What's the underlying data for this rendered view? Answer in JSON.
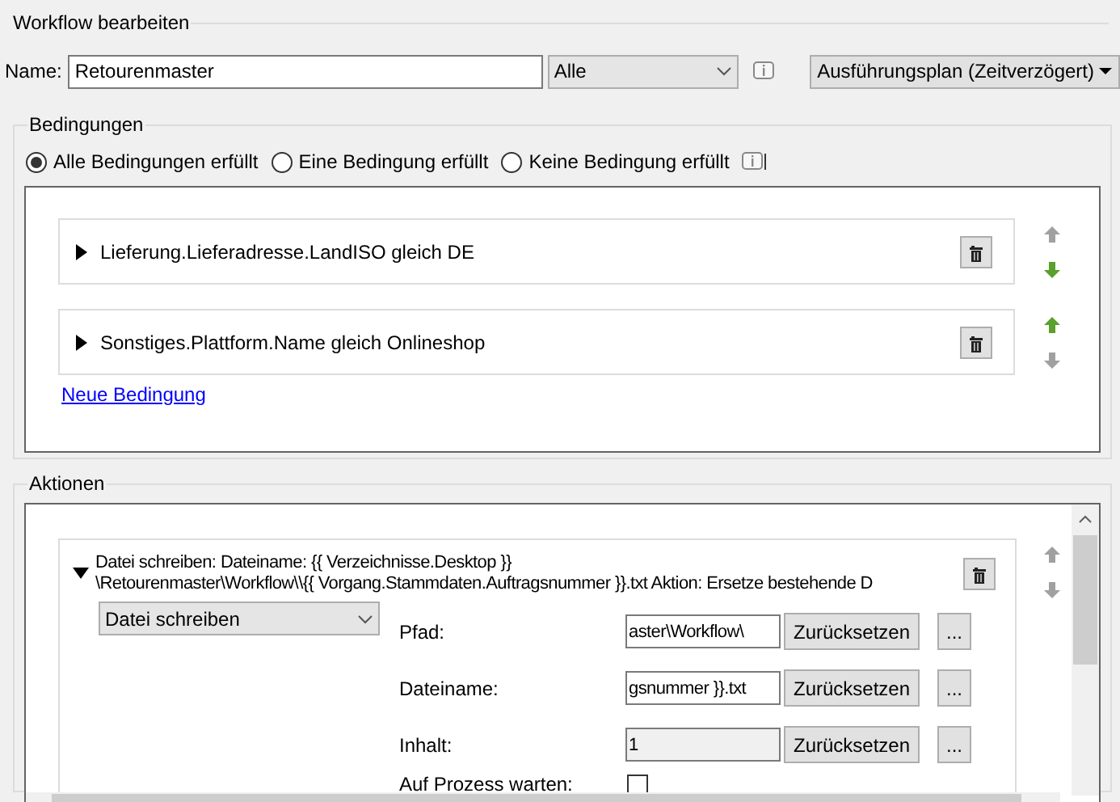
{
  "group_title": "Workflow bearbeiten",
  "name": {
    "label": "Name:",
    "value": "Retourenmaster"
  },
  "filter_dropdown": {
    "value": "Alle"
  },
  "schedule_button": {
    "label": "Ausführungsplan (Zeitverzögert)"
  },
  "conditions": {
    "title": "Bedingungen",
    "modes": [
      {
        "label": "Alle Bedingungen erfüllt",
        "selected": true
      },
      {
        "label": "Eine Bedingung erfüllt",
        "selected": false
      },
      {
        "label": "Keine Bedingung erfüllt",
        "selected": false
      }
    ],
    "rows": [
      {
        "text": "Lieferung.Lieferadresse.LandISO gleich DE",
        "expanded": false,
        "can_move_up": false,
        "can_move_down": true
      },
      {
        "text": "Sonstiges.Plattform.Name gleich Onlineshop",
        "expanded": false,
        "can_move_up": true,
        "can_move_down": false
      }
    ],
    "add_link": "Neue Bedingung"
  },
  "actions": {
    "title": "Aktionen",
    "rows": [
      {
        "summary_lines": [
          "Datei schreiben: Dateiname: {{ Verzeichnisse.Desktop }}",
          "\\Retourenmaster\\Workflow\\\\{{ Vorgang.Stammdaten.Auftragsnummer }}.txt  Aktion: Ersetze bestehende D"
        ],
        "expanded": true,
        "can_move_up": false,
        "can_move_down": false,
        "type": "Datei schreiben",
        "fields": [
          {
            "label": "Pfad:",
            "value": "aster\\Workflow\\",
            "disabled": false,
            "reset": "Zurücksetzen",
            "browse": "..."
          },
          {
            "label": "Dateiname:",
            "value": "gsnummer }}.txt",
            "disabled": false,
            "reset": "Zurücksetzen",
            "browse": "..."
          },
          {
            "label": "Inhalt:",
            "value": "1",
            "disabled": true,
            "reset": "Zurücksetzen",
            "browse": "..."
          }
        ],
        "wait": {
          "label": "Auf Prozess warten:",
          "checked": false
        }
      }
    ]
  }
}
